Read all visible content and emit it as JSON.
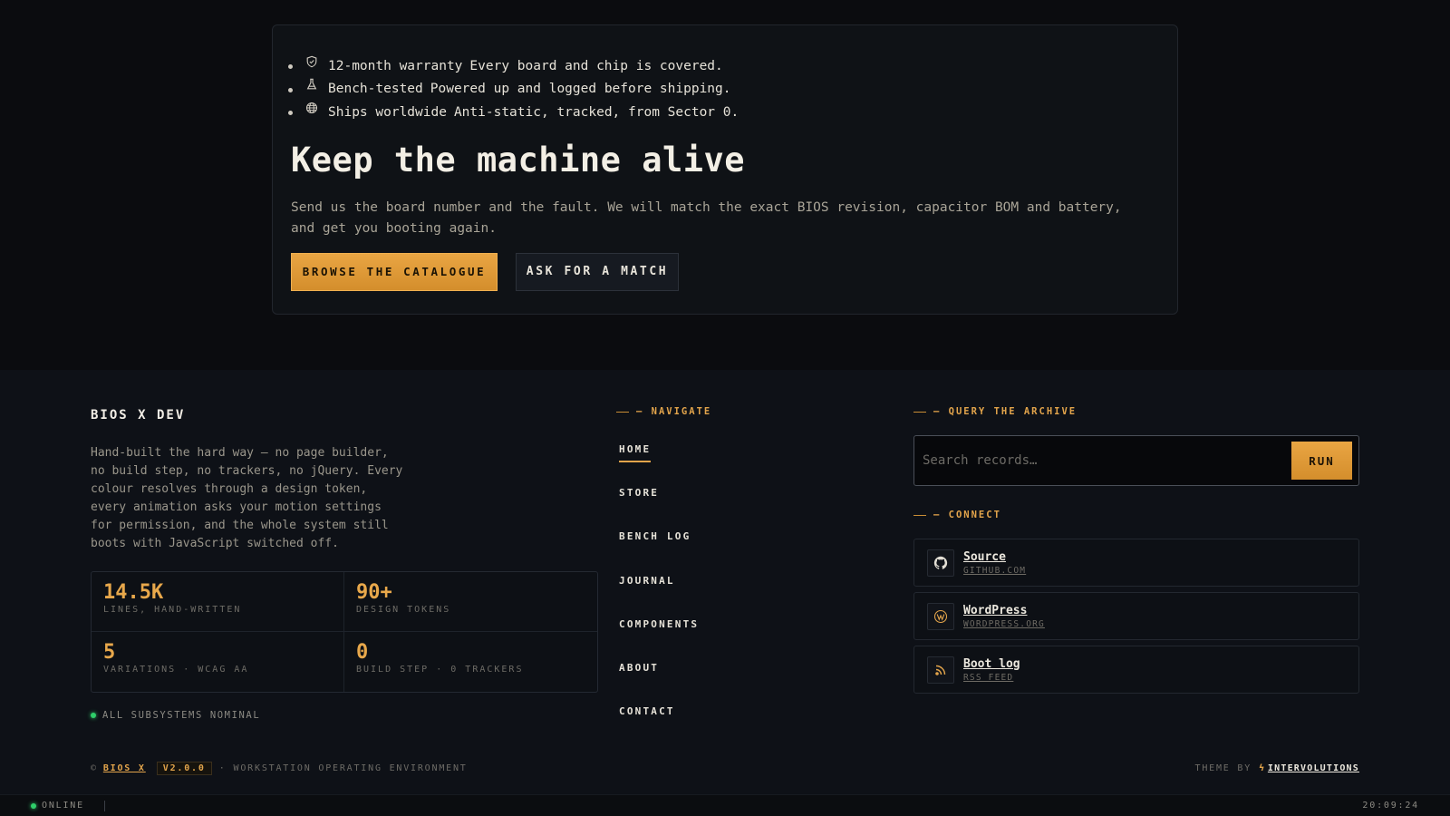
{
  "cta": {
    "perks": [
      {
        "icon": "shield-icon",
        "title": "12-month warranty",
        "desc": "Every board and chip is covered."
      },
      {
        "icon": "flask-icon",
        "title": "Bench-tested",
        "desc": "Powered up and logged before shipping."
      },
      {
        "icon": "globe-icon",
        "title": "Ships worldwide",
        "desc": "Anti-static, tracked, from Sector 0."
      }
    ],
    "title": "Keep the machine alive",
    "text": "Send us the board number and the fault. We will match the exact BIOS revision, capacitor BOM and battery, and get you booting again.",
    "primary_button": "BROWSE THE CATALOGUE",
    "secondary_button": "ASK FOR A MATCH"
  },
  "footer": {
    "brand": {
      "name": "BIOS X DEV",
      "description": "Hand-built the hard way — no page builder, no build step, no trackers, no jQuery. Every colour resolves through a design token, every animation asks your motion settings for permission, and the whole system still boots with JavaScript switched off.",
      "stats": [
        {
          "value": "14.5K",
          "label": "LINES, HAND-WRITTEN"
        },
        {
          "value": "90+",
          "label": "DESIGN TOKENS"
        },
        {
          "value": "5",
          "label": "VARIATIONS · WCAG AA"
        },
        {
          "value": "0",
          "label": "BUILD STEP · 0 TRACKERS"
        }
      ],
      "status": "ALL SUBSYSTEMS NOMINAL"
    },
    "nav": {
      "heading": "— NAVIGATE",
      "items": [
        "HOME",
        "STORE",
        "BENCH LOG",
        "JOURNAL",
        "COMPONENTS",
        "ABOUT",
        "CONTACT"
      ],
      "active": "HOME"
    },
    "search": {
      "heading": "— QUERY THE ARCHIVE",
      "placeholder": "Search records…",
      "button": "RUN"
    },
    "connect": {
      "heading": "— CONNECT",
      "items": [
        {
          "icon": "github-icon",
          "name": "Source",
          "sub": "GITHUB.COM"
        },
        {
          "icon": "wordpress-icon",
          "name": "WordPress",
          "sub": "WORDPRESS.ORG"
        },
        {
          "icon": "rss-icon",
          "name": "Boot log",
          "sub": "RSS FEED"
        }
      ]
    },
    "bottom": {
      "copyright": "©",
      "brand_link": "BIOS X",
      "version": "V2.0.0",
      "separator": "·",
      "tagline": "WORKSTATION OPERATING ENVIRONMENT",
      "theme_by": "THEME BY",
      "theme_link": "INTERVOLUTIONS"
    }
  },
  "statusbar": {
    "online": "ONLINE",
    "clock": "20:09:24"
  },
  "colors": {
    "accent": "#e2a44b",
    "background": "#0c0e12",
    "status_green": "#2fcf6a"
  }
}
